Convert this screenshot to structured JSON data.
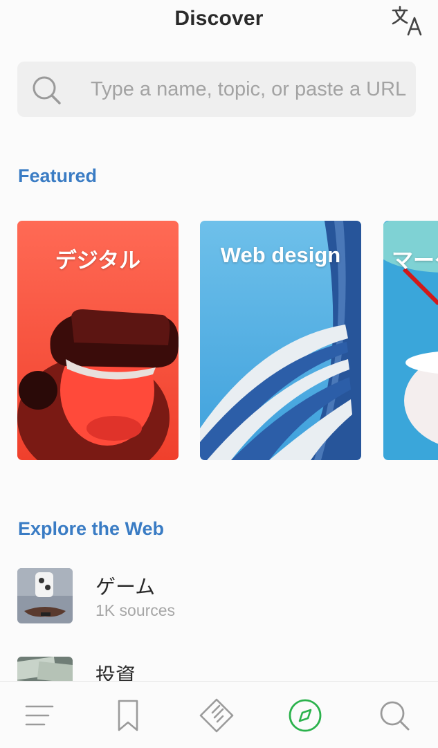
{
  "header": {
    "title": "Discover",
    "translate_icon": "translate-icon"
  },
  "search": {
    "placeholder": "Type a name, topic, or paste a URL",
    "icon": "search-icon"
  },
  "featured": {
    "title": "Featured",
    "cards": [
      {
        "label": "デジタル",
        "image": "vr-headset-red"
      },
      {
        "label": "Web design",
        "image": "blue-architecture"
      },
      {
        "label": "マーケ",
        "image": "teapot-cup-blue"
      }
    ]
  },
  "explore": {
    "title": "Explore the Web",
    "items": [
      {
        "title": "ゲーム",
        "subtitle": "1K sources",
        "image": "game-controller"
      },
      {
        "title": "投資",
        "subtitle": "",
        "image": "money-bills"
      }
    ]
  },
  "bottom_nav": {
    "items": [
      {
        "icon": "menu-icon",
        "active": false
      },
      {
        "icon": "bookmark-icon",
        "active": false
      },
      {
        "icon": "feed-tag-icon",
        "active": false
      },
      {
        "icon": "compass-icon",
        "active": true
      },
      {
        "icon": "search-icon",
        "active": false
      }
    ]
  },
  "colors": {
    "accent": "#3a7cc4",
    "active_nav": "#2bb24c",
    "inactive_nav": "#9a9a9a",
    "background": "#fbfbfb"
  }
}
